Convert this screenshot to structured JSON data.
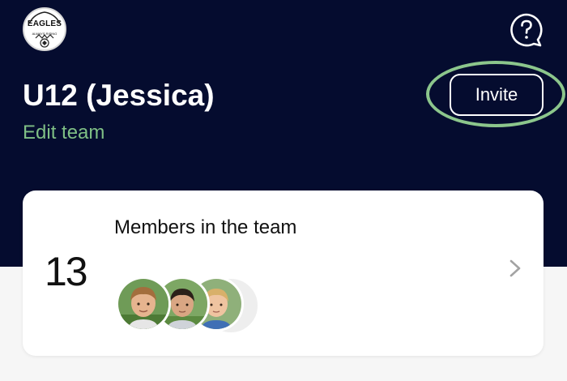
{
  "header": {
    "logo": {
      "text": "EAGLES",
      "subtext": "ALWAYS RISING",
      "icon": "eagles-club-logo"
    },
    "help_icon": "help-bubble-icon",
    "team_name": "U12 (Jessica)",
    "edit_link": "Edit team",
    "invite_label": "Invite"
  },
  "members_card": {
    "count": "13",
    "title": "Members in the team",
    "more_label": "···",
    "avatars": [
      "member-avatar",
      "member-avatar",
      "member-avatar"
    ],
    "chevron_icon": "chevron-right-icon"
  },
  "colors": {
    "header_bg": "#050c2f",
    "accent_green": "#7fbf85",
    "highlight_ring": "#8cc68c",
    "page_bg": "#f6f6f6",
    "card_bg": "#ffffff"
  }
}
